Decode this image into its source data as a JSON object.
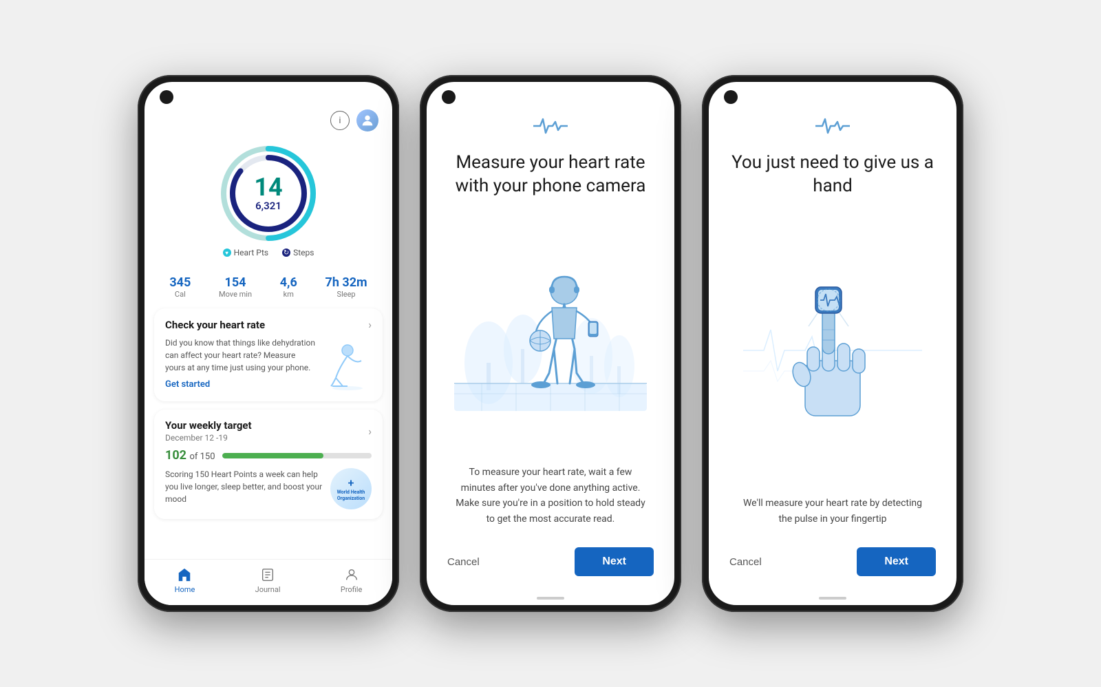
{
  "phone1": {
    "stats": {
      "heartPts": "14",
      "steps": "6,321",
      "heartPtsLabel": "Heart Pts",
      "stepsLabel": "Steps",
      "cal": "345",
      "calLabel": "Cal",
      "moveMin": "154",
      "moveMinLabel": "Move min",
      "km": "4,6",
      "kmLabel": "km",
      "sleep": "7h 32m",
      "sleepLabel": "Sleep"
    },
    "heartRateCard": {
      "title": "Check your heart rate",
      "text": "Did you know that things like dehydration can affect your heart rate? Measure yours at any time just using your phone.",
      "cta": "Get started"
    },
    "weeklyCard": {
      "title": "Your weekly target",
      "date": "December 12 -19",
      "pts": "102",
      "ptsOf": "of 150",
      "progress": 68,
      "text": "Scoring 150 Heart Points a week can help you live longer, sleep better, and boost your mood",
      "badgeText": "World Health Organization"
    },
    "nav": {
      "home": "Home",
      "journal": "Journal",
      "profile": "Profile"
    }
  },
  "phone2": {
    "pulseIcon": "〜",
    "title": "Measure your heart rate with your phone camera",
    "description": "To measure your heart rate, wait a few minutes after you've done anything active. Make sure you're in a position to hold steady to get the most accurate read.",
    "cancelLabel": "Cancel",
    "nextLabel": "Next"
  },
  "phone3": {
    "pulseIcon": "〜",
    "title": "You just need to give us a hand",
    "description": "We'll measure your heart rate by detecting the pulse in your fingertip",
    "cancelLabel": "Cancel",
    "nextLabel": "Next"
  }
}
